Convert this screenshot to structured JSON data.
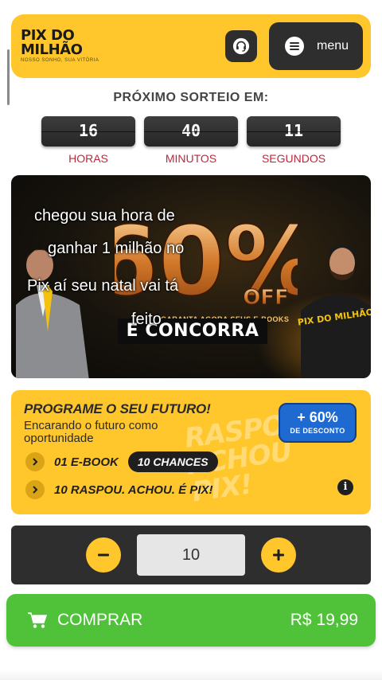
{
  "header": {
    "logo_line1": "PIX DO",
    "logo_line2": "MILHÃO",
    "logo_tagline": "NOSSO SONHO, SUA VITÓRIA",
    "support_icon": "headset-icon",
    "menu_label": "menu",
    "colors": {
      "header_bg": "#ffc72c",
      "button_bg": "#2e2e2e"
    }
  },
  "countdown": {
    "title": "PRÓXIMO SORTEIO EM:",
    "units": [
      {
        "value": "16",
        "label": "HORAS"
      },
      {
        "value": "40",
        "label": "MINUTOS"
      },
      {
        "value": "11",
        "label": "SEGUNDOS"
      }
    ],
    "label_color": "#c0263b"
  },
  "banner": {
    "big_text": "60%",
    "off_text": "OFF",
    "promo_text": "GARANTA AGORA SEUS E-BOOKS",
    "cta_text": "E CONCORRA",
    "shirt_text": "PIX DO MILHÃO",
    "caption_lines": [
      "chegou sua hora de",
      "ganhar 1 milhão no",
      "Pix aí seu natal vai tá",
      "feito"
    ]
  },
  "offer": {
    "title": "PROGRAME O SEU FUTURO!",
    "subtitle": "Encarando o futuro como oportunidade",
    "badge_value": "+ 60%",
    "badge_label": "DE DESCONTO",
    "features": [
      {
        "text": "01 E-BOOK",
        "tag": "10 CHANCES"
      },
      {
        "text": "10 RASPOU. ACHOU. É PIX!",
        "tag": ""
      }
    ],
    "background_text": "RASPOU ACHOU PIX!",
    "info_icon": "info-icon",
    "colors": {
      "badge_bg": "#1e6ad1",
      "card_bg": "#ffc72c"
    }
  },
  "quantity": {
    "value": "10",
    "decrement_icon": "minus-icon",
    "increment_icon": "plus-icon"
  },
  "buy": {
    "label": "COMPRAR",
    "price": "R$ 19,99",
    "icon": "cart-icon",
    "color": "#4fc23a"
  }
}
